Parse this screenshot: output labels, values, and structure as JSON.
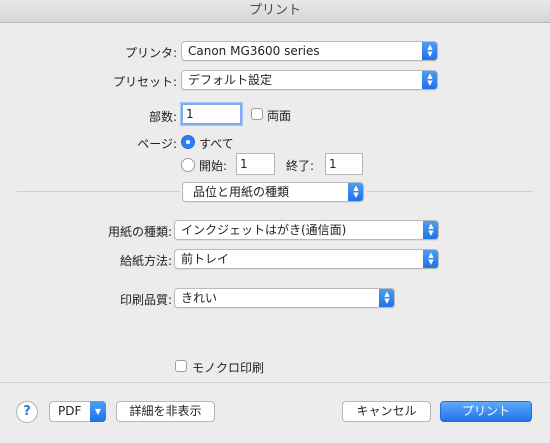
{
  "window": {
    "title": "プリント"
  },
  "printer": {
    "label": "プリンタ:",
    "value": "Canon MG3600 series"
  },
  "preset": {
    "label": "プリセット:",
    "value": "デフォルト設定"
  },
  "copies": {
    "label": "部数:",
    "value": "1",
    "duplex_label": "両面",
    "duplex_checked": false
  },
  "pages": {
    "label": "ページ:",
    "all_label": "すべて",
    "all_selected": true,
    "from_label": "開始:",
    "from_value": "1",
    "to_label": "終了:",
    "to_value": "1"
  },
  "section": {
    "value": "品位と用紙の種類"
  },
  "media_type": {
    "label": "用紙の種類:",
    "value": "インクジェットはがき(通信面)"
  },
  "paper_source": {
    "label": "給紙方法:",
    "value": "前トレイ"
  },
  "quality": {
    "label": "印刷品質:",
    "value": "きれい"
  },
  "grayscale": {
    "label": "モノクロ印刷",
    "checked": false
  },
  "footer": {
    "help_label": "?",
    "pdf_label": "PDF",
    "hide_details_label": "詳細を非表示",
    "cancel_label": "キャンセル",
    "print_label": "プリント"
  },
  "colors": {
    "accent": "#1f74ea",
    "focus_ring": "#7cadf2",
    "background": "#ececec"
  }
}
